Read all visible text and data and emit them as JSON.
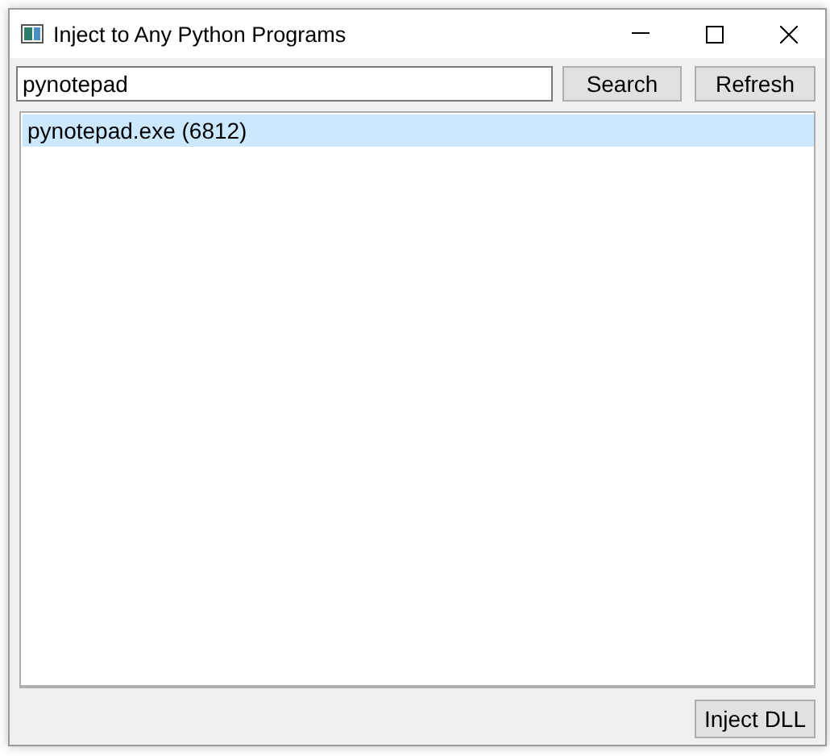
{
  "window": {
    "title": "Inject to Any Python Programs"
  },
  "search": {
    "value": "pynotepad"
  },
  "buttons": [
    "Search",
    "Refresh"
  ],
  "processes": [
    {
      "label": "pynotepad.exe (6812)",
      "selected": true
    }
  ],
  "footer_button": "Inject DLL"
}
